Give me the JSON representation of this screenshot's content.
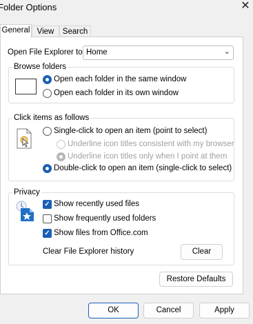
{
  "window": {
    "title": "Folder Options"
  },
  "tabs": [
    "General",
    "View",
    "Search"
  ],
  "general": {
    "open_explorer_label": "Open File Explorer to:",
    "open_explorer_value": "Home",
    "browse": {
      "legend": "Browse folders",
      "same_window": "Open each folder in the same window",
      "own_window": "Open each folder in its own window",
      "selected": "same_window"
    },
    "click": {
      "legend": "Click items as follows",
      "single": "Single-click to open an item (point to select)",
      "underline_browser": "Underline icon titles consistent with my browser",
      "underline_point": "Underline icon titles only when I point at them",
      "double": "Double-click to open an item (single-click to select)",
      "selected": "double"
    },
    "privacy": {
      "legend": "Privacy",
      "recent_files": "Show recently used files",
      "frequent_folders": "Show frequently used folders",
      "office_files": "Show files from Office.com",
      "recent_files_checked": true,
      "frequent_folders_checked": false,
      "office_files_checked": true,
      "clear_history_label": "Clear File Explorer history",
      "clear_button": "Clear"
    },
    "restore_defaults": "Restore Defaults"
  },
  "footer": {
    "ok": "OK",
    "cancel": "Cancel",
    "apply": "Apply"
  },
  "colors": {
    "accent": "#1a5fb4",
    "folder_yellow": "#e8b84a",
    "privacy_blue": "#1f6fc5"
  }
}
